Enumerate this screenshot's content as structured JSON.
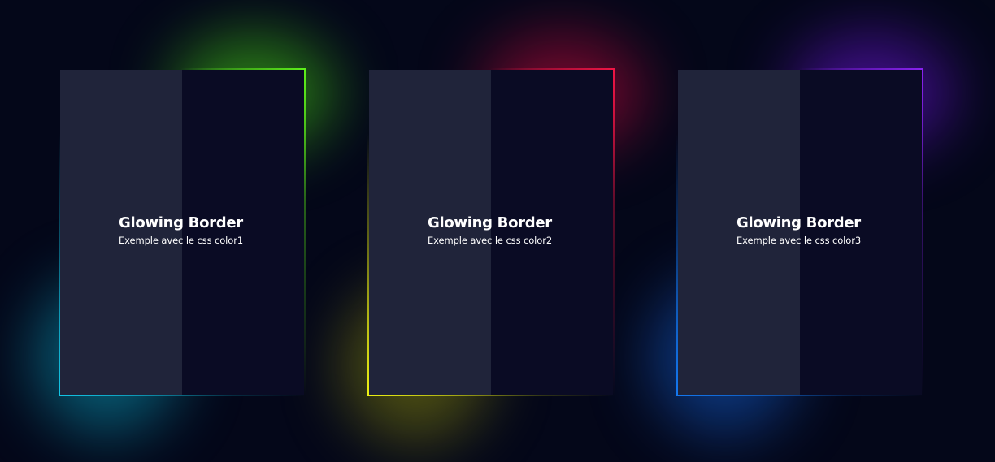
{
  "cards": [
    {
      "title": "Glowing Border",
      "subtitle": "Exemple avec le css color1",
      "accent_primary": "#5ef01a",
      "accent_secondary": "#13c6e6"
    },
    {
      "title": "Glowing Border",
      "subtitle": "Exemple avec le css color2",
      "accent_primary": "#f01545",
      "accent_secondary": "#eef214"
    },
    {
      "title": "Glowing Border",
      "subtitle": "Exemple avec le css color3",
      "accent_primary": "#8a22f0",
      "accent_secondary": "#1478f0"
    }
  ],
  "colors": {
    "background": "#040719",
    "card_left": "#20243a",
    "card_right": "#0a0b24",
    "text": "#ffffff"
  }
}
